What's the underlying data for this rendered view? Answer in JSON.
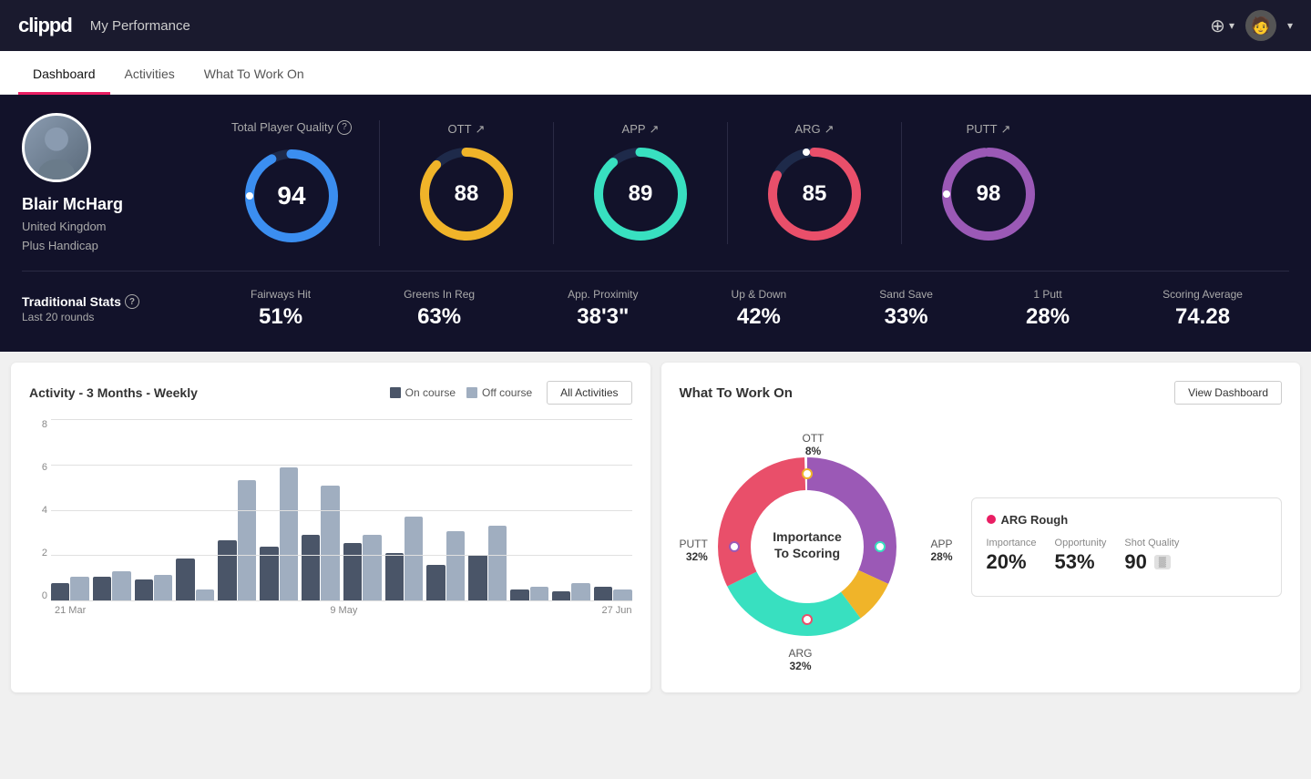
{
  "header": {
    "logo": "clippd",
    "title": "My Performance",
    "add_icon": "⊕",
    "avatar_icon": "👤"
  },
  "tabs": [
    {
      "id": "dashboard",
      "label": "Dashboard",
      "active": true
    },
    {
      "id": "activities",
      "label": "Activities",
      "active": false
    },
    {
      "id": "what-to-work-on",
      "label": "What To Work On",
      "active": false
    }
  ],
  "player": {
    "name": "Blair McHarg",
    "country": "United Kingdom",
    "handicap": "Plus Handicap",
    "avatar_icon": "🧍"
  },
  "total_quality": {
    "label": "Total Player Quality",
    "value": 94,
    "color": "#3b8ef0"
  },
  "score_cards": [
    {
      "id": "ott",
      "label": "OTT",
      "value": 88,
      "color": "#f0b429",
      "arrow": "↗"
    },
    {
      "id": "app",
      "label": "APP",
      "value": 89,
      "color": "#38e0c0",
      "arrow": "↗"
    },
    {
      "id": "arg",
      "label": "ARG",
      "value": 85,
      "color": "#e94f6a",
      "arrow": "↗"
    },
    {
      "id": "putt",
      "label": "PUTT",
      "value": 98,
      "color": "#9b59b6",
      "arrow": "↗"
    }
  ],
  "trad_stats": {
    "title": "Traditional Stats",
    "subtitle": "Last 20 rounds",
    "items": [
      {
        "label": "Fairways Hit",
        "value": "51%"
      },
      {
        "label": "Greens In Reg",
        "value": "63%"
      },
      {
        "label": "App. Proximity",
        "value": "38'3\""
      },
      {
        "label": "Up & Down",
        "value": "42%"
      },
      {
        "label": "Sand Save",
        "value": "33%"
      },
      {
        "label": "1 Putt",
        "value": "28%"
      },
      {
        "label": "Scoring Average",
        "value": "74.28"
      }
    ]
  },
  "activity_chart": {
    "title": "Activity - 3 Months - Weekly",
    "legend": [
      {
        "label": "On course",
        "color": "#4a5568"
      },
      {
        "label": "Off course",
        "color": "#a0aec0"
      }
    ],
    "button_label": "All Activities",
    "y_labels": [
      "0",
      "2",
      "4",
      "6",
      "8"
    ],
    "x_labels": [
      "21 Mar",
      "9 May",
      "27 Jun"
    ],
    "bars": [
      {
        "dark": 15,
        "light": 20
      },
      {
        "dark": 20,
        "light": 25
      },
      {
        "dark": 18,
        "light": 22
      },
      {
        "dark": 35,
        "light": 10
      },
      {
        "dark": 50,
        "light": 100
      },
      {
        "dark": 45,
        "light": 110
      },
      {
        "dark": 55,
        "light": 95
      },
      {
        "dark": 48,
        "light": 55
      },
      {
        "dark": 40,
        "light": 70
      },
      {
        "dark": 30,
        "light": 58
      },
      {
        "dark": 38,
        "light": 62
      },
      {
        "dark": 10,
        "light": 12
      },
      {
        "dark": 8,
        "light": 15
      },
      {
        "dark": 12,
        "light": 10
      }
    ]
  },
  "what_to_work_on": {
    "title": "What To Work On",
    "button_label": "View Dashboard",
    "donut_center": "Importance\nTo Scoring",
    "segments": [
      {
        "label": "OTT",
        "value": "8%",
        "color": "#f0b429",
        "position": "top"
      },
      {
        "label": "APP",
        "value": "28%",
        "color": "#38e0c0",
        "position": "right"
      },
      {
        "label": "ARG",
        "value": "32%",
        "color": "#e94f6a",
        "position": "bottom"
      },
      {
        "label": "PUTT",
        "value": "32%",
        "color": "#9b59b6",
        "position": "left"
      }
    ],
    "info_card": {
      "title": "ARG Rough",
      "dot_color": "#e91e63",
      "stats": [
        {
          "label": "Importance",
          "value": "20%"
        },
        {
          "label": "Opportunity",
          "value": "53%"
        },
        {
          "label": "Shot Quality",
          "value": "90",
          "badge": ""
        }
      ]
    }
  }
}
